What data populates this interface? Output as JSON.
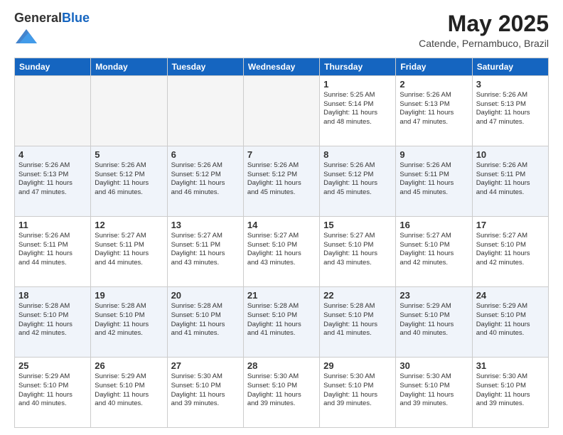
{
  "header": {
    "logo_general": "General",
    "logo_blue": "Blue",
    "month_year": "May 2025",
    "location": "Catende, Pernambuco, Brazil"
  },
  "days_of_week": [
    "Sunday",
    "Monday",
    "Tuesday",
    "Wednesday",
    "Thursday",
    "Friday",
    "Saturday"
  ],
  "weeks": [
    {
      "row_class": "row-odd",
      "days": [
        {
          "number": "",
          "info": "",
          "empty": true
        },
        {
          "number": "",
          "info": "",
          "empty": true
        },
        {
          "number": "",
          "info": "",
          "empty": true
        },
        {
          "number": "",
          "info": "",
          "empty": true
        },
        {
          "number": "1",
          "info": "Sunrise: 5:25 AM\nSunset: 5:14 PM\nDaylight: 11 hours\nand 48 minutes.",
          "empty": false
        },
        {
          "number": "2",
          "info": "Sunrise: 5:26 AM\nSunset: 5:13 PM\nDaylight: 11 hours\nand 47 minutes.",
          "empty": false
        },
        {
          "number": "3",
          "info": "Sunrise: 5:26 AM\nSunset: 5:13 PM\nDaylight: 11 hours\nand 47 minutes.",
          "empty": false
        }
      ]
    },
    {
      "row_class": "row-even",
      "days": [
        {
          "number": "4",
          "info": "Sunrise: 5:26 AM\nSunset: 5:13 PM\nDaylight: 11 hours\nand 47 minutes.",
          "empty": false
        },
        {
          "number": "5",
          "info": "Sunrise: 5:26 AM\nSunset: 5:12 PM\nDaylight: 11 hours\nand 46 minutes.",
          "empty": false
        },
        {
          "number": "6",
          "info": "Sunrise: 5:26 AM\nSunset: 5:12 PM\nDaylight: 11 hours\nand 46 minutes.",
          "empty": false
        },
        {
          "number": "7",
          "info": "Sunrise: 5:26 AM\nSunset: 5:12 PM\nDaylight: 11 hours\nand 45 minutes.",
          "empty": false
        },
        {
          "number": "8",
          "info": "Sunrise: 5:26 AM\nSunset: 5:12 PM\nDaylight: 11 hours\nand 45 minutes.",
          "empty": false
        },
        {
          "number": "9",
          "info": "Sunrise: 5:26 AM\nSunset: 5:11 PM\nDaylight: 11 hours\nand 45 minutes.",
          "empty": false
        },
        {
          "number": "10",
          "info": "Sunrise: 5:26 AM\nSunset: 5:11 PM\nDaylight: 11 hours\nand 44 minutes.",
          "empty": false
        }
      ]
    },
    {
      "row_class": "row-odd",
      "days": [
        {
          "number": "11",
          "info": "Sunrise: 5:26 AM\nSunset: 5:11 PM\nDaylight: 11 hours\nand 44 minutes.",
          "empty": false
        },
        {
          "number": "12",
          "info": "Sunrise: 5:27 AM\nSunset: 5:11 PM\nDaylight: 11 hours\nand 44 minutes.",
          "empty": false
        },
        {
          "number": "13",
          "info": "Sunrise: 5:27 AM\nSunset: 5:11 PM\nDaylight: 11 hours\nand 43 minutes.",
          "empty": false
        },
        {
          "number": "14",
          "info": "Sunrise: 5:27 AM\nSunset: 5:10 PM\nDaylight: 11 hours\nand 43 minutes.",
          "empty": false
        },
        {
          "number": "15",
          "info": "Sunrise: 5:27 AM\nSunset: 5:10 PM\nDaylight: 11 hours\nand 43 minutes.",
          "empty": false
        },
        {
          "number": "16",
          "info": "Sunrise: 5:27 AM\nSunset: 5:10 PM\nDaylight: 11 hours\nand 42 minutes.",
          "empty": false
        },
        {
          "number": "17",
          "info": "Sunrise: 5:27 AM\nSunset: 5:10 PM\nDaylight: 11 hours\nand 42 minutes.",
          "empty": false
        }
      ]
    },
    {
      "row_class": "row-even",
      "days": [
        {
          "number": "18",
          "info": "Sunrise: 5:28 AM\nSunset: 5:10 PM\nDaylight: 11 hours\nand 42 minutes.",
          "empty": false
        },
        {
          "number": "19",
          "info": "Sunrise: 5:28 AM\nSunset: 5:10 PM\nDaylight: 11 hours\nand 42 minutes.",
          "empty": false
        },
        {
          "number": "20",
          "info": "Sunrise: 5:28 AM\nSunset: 5:10 PM\nDaylight: 11 hours\nand 41 minutes.",
          "empty": false
        },
        {
          "number": "21",
          "info": "Sunrise: 5:28 AM\nSunset: 5:10 PM\nDaylight: 11 hours\nand 41 minutes.",
          "empty": false
        },
        {
          "number": "22",
          "info": "Sunrise: 5:28 AM\nSunset: 5:10 PM\nDaylight: 11 hours\nand 41 minutes.",
          "empty": false
        },
        {
          "number": "23",
          "info": "Sunrise: 5:29 AM\nSunset: 5:10 PM\nDaylight: 11 hours\nand 40 minutes.",
          "empty": false
        },
        {
          "number": "24",
          "info": "Sunrise: 5:29 AM\nSunset: 5:10 PM\nDaylight: 11 hours\nand 40 minutes.",
          "empty": false
        }
      ]
    },
    {
      "row_class": "row-odd",
      "days": [
        {
          "number": "25",
          "info": "Sunrise: 5:29 AM\nSunset: 5:10 PM\nDaylight: 11 hours\nand 40 minutes.",
          "empty": false
        },
        {
          "number": "26",
          "info": "Sunrise: 5:29 AM\nSunset: 5:10 PM\nDaylight: 11 hours\nand 40 minutes.",
          "empty": false
        },
        {
          "number": "27",
          "info": "Sunrise: 5:30 AM\nSunset: 5:10 PM\nDaylight: 11 hours\nand 39 minutes.",
          "empty": false
        },
        {
          "number": "28",
          "info": "Sunrise: 5:30 AM\nSunset: 5:10 PM\nDaylight: 11 hours\nand 39 minutes.",
          "empty": false
        },
        {
          "number": "29",
          "info": "Sunrise: 5:30 AM\nSunset: 5:10 PM\nDaylight: 11 hours\nand 39 minutes.",
          "empty": false
        },
        {
          "number": "30",
          "info": "Sunrise: 5:30 AM\nSunset: 5:10 PM\nDaylight: 11 hours\nand 39 minutes.",
          "empty": false
        },
        {
          "number": "31",
          "info": "Sunrise: 5:30 AM\nSunset: 5:10 PM\nDaylight: 11 hours\nand 39 minutes.",
          "empty": false
        }
      ]
    }
  ]
}
